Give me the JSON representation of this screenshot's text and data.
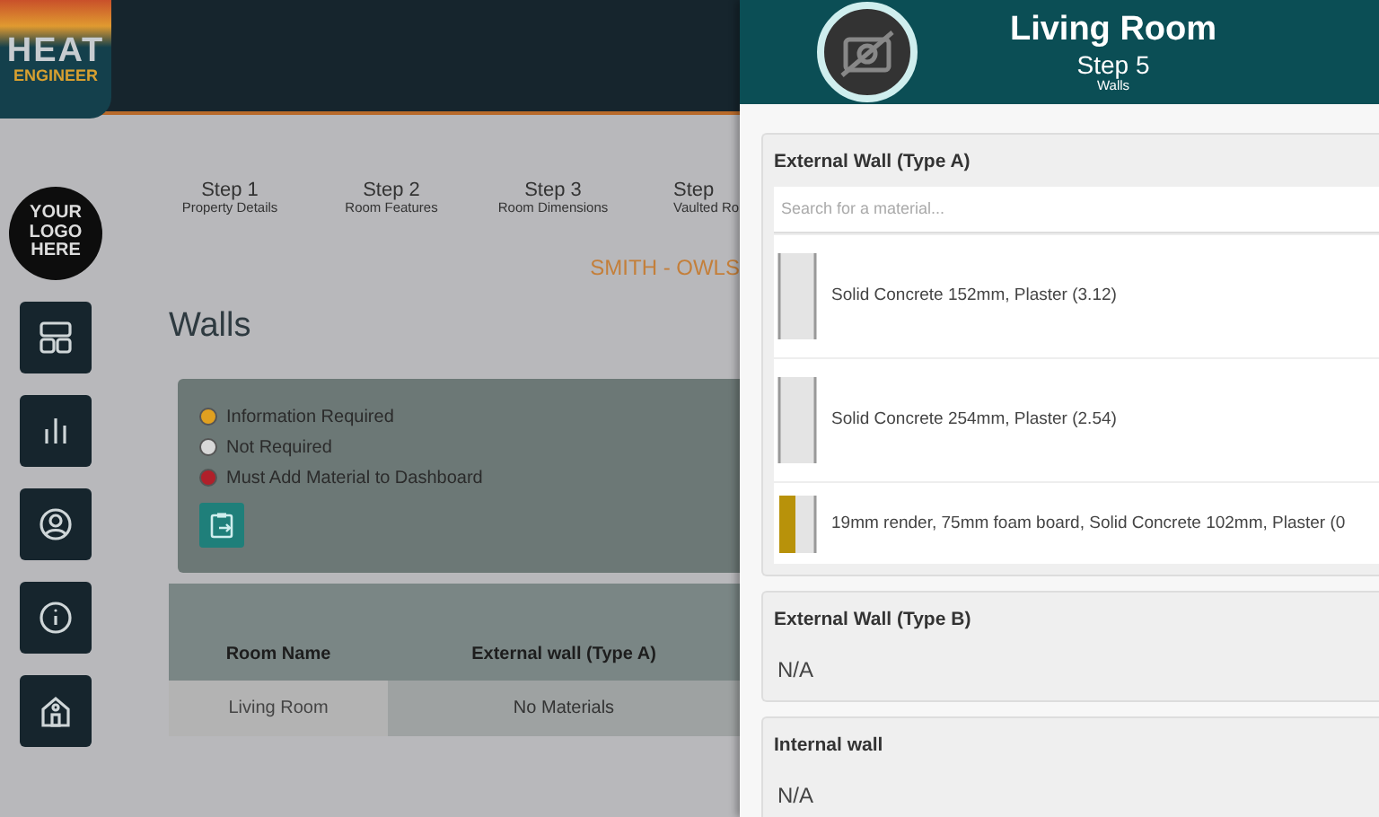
{
  "app": {
    "logo_top": "HEAT",
    "logo_bottom": "ENGINEER",
    "company_logo": [
      "YOUR",
      "LOGO",
      "HERE"
    ]
  },
  "sidebar": {
    "items": [
      {
        "kind": "dashboard"
      },
      {
        "kind": "chart"
      },
      {
        "kind": "user"
      },
      {
        "kind": "info"
      },
      {
        "kind": "building"
      }
    ]
  },
  "steps": [
    {
      "title": "Step 1",
      "label": "Property Details"
    },
    {
      "title": "Step 2",
      "label": "Room Features"
    },
    {
      "title": "Step 3",
      "label": "Room Dimensions"
    },
    {
      "title": "Step",
      "label": "Vaulted Ro"
    }
  ],
  "property": "SMITH - OWLS",
  "page_title": "Walls",
  "legend": [
    {
      "label": "Information Required",
      "color": "#e0a020"
    },
    {
      "label": "Not Required",
      "color": "#d8d8d8"
    },
    {
      "label": "Must Add Material to Dashboard",
      "color": "#b0202a"
    }
  ],
  "table": {
    "columns": [
      "Room Name",
      "External wall (Type A)"
    ],
    "rows": [
      [
        "Living Room",
        "No Materials"
      ]
    ]
  },
  "panel": {
    "title": "Living Room",
    "step": "Step 5",
    "subtitle": "Walls",
    "sections": [
      {
        "title": "External Wall (Type A)",
        "search": {
          "placeholder": "Search for a material..."
        },
        "materials": [
          {
            "label": "Solid Concrete 152mm, Plaster (3.12)",
            "kind": "plain"
          },
          {
            "label": "Solid Concrete 254mm, Plaster (2.54)",
            "kind": "plain"
          },
          {
            "label": "19mm render, 75mm foam board, Solid Concrete 102mm, Plaster (0",
            "kind": "rendered"
          }
        ]
      },
      {
        "title": "External Wall (Type B)",
        "value": "N/A"
      },
      {
        "title": "Internal wall",
        "value": "N/A"
      }
    ]
  }
}
